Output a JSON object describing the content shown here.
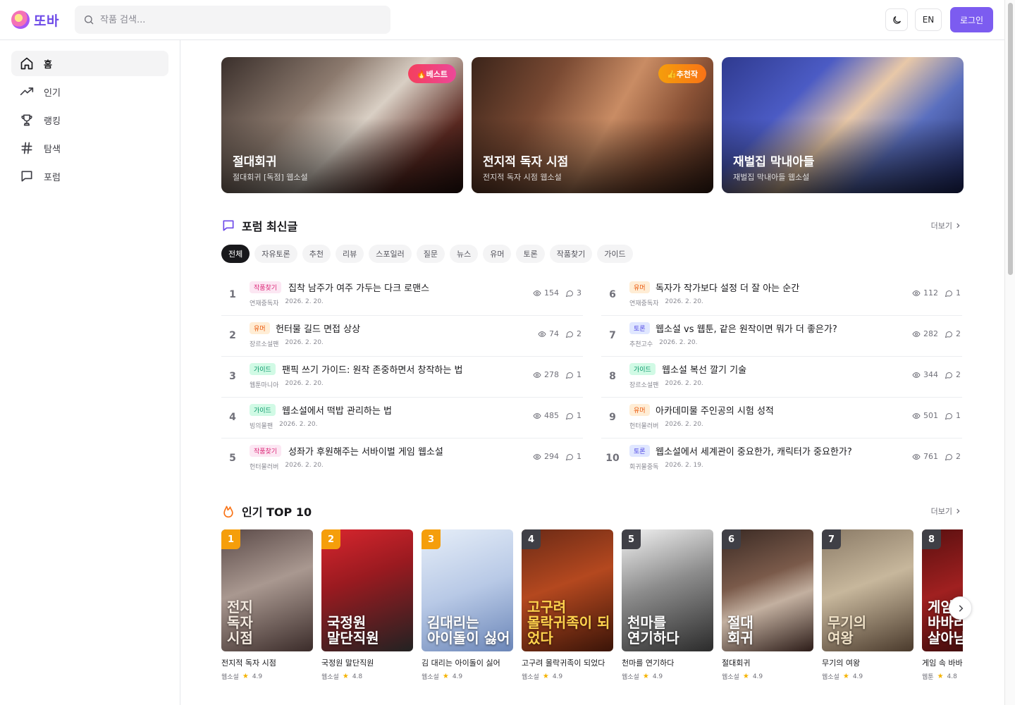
{
  "header": {
    "logo_text": "또바",
    "search_placeholder": "작품 검색...",
    "lang_label": "EN",
    "login_label": "로그인"
  },
  "sidebar": {
    "items": [
      {
        "label": "홈",
        "icon": "home-icon",
        "active": true
      },
      {
        "label": "인기",
        "icon": "trending-icon",
        "active": false
      },
      {
        "label": "랭킹",
        "icon": "trophy-icon",
        "active": false
      },
      {
        "label": "탐색",
        "icon": "hash-icon",
        "active": false
      },
      {
        "label": "포럼",
        "icon": "chat-icon",
        "active": false
      }
    ]
  },
  "banners": [
    {
      "title": "절대회귀",
      "subtitle": "절대회귀 [독점] 웹소설",
      "badge": "🔥베스트",
      "badge_color": "#f0407d"
    },
    {
      "title": "전지적 독자 시점",
      "subtitle": "전지적 독자 시점 웹소설",
      "badge": "👍추천작",
      "badge_color": "#f59e0b"
    },
    {
      "title": "재벌집 막내아들",
      "subtitle": "재벌집 막내아들 웹소설",
      "badge": "",
      "badge_color": ""
    }
  ],
  "forum": {
    "title": "포럼 최신글",
    "more_label": "더보기",
    "filters": [
      "전체",
      "자유토론",
      "추천",
      "리뷰",
      "스포일러",
      "질문",
      "뉴스",
      "유머",
      "토론",
      "작품찾기",
      "가이드"
    ],
    "posts": [
      {
        "rank": "1",
        "tag": "작품찾기",
        "title": "집착 남주가 여주 가두는 다크 로맨스",
        "author": "연재중독자",
        "date": "2026. 2. 20.",
        "views": "154",
        "comments": "3"
      },
      {
        "rank": "2",
        "tag": "유머",
        "title": "헌터물 길드 면접 상상",
        "author": "장르소설팬",
        "date": "2026. 2. 20.",
        "views": "74",
        "comments": "2"
      },
      {
        "rank": "3",
        "tag": "가이드",
        "title": "팬픽 쓰기 가이드: 원작 존중하면서 창작하는 법",
        "author": "웹툰마니아",
        "date": "2026. 2. 20.",
        "views": "278",
        "comments": "1"
      },
      {
        "rank": "4",
        "tag": "가이드",
        "title": "웹소설에서 떡밥 관리하는 법",
        "author": "빙의물팬",
        "date": "2026. 2. 20.",
        "views": "485",
        "comments": "1"
      },
      {
        "rank": "5",
        "tag": "작품찾기",
        "title": "성좌가 후원해주는 서바이벌 게임 웹소설",
        "author": "헌터물러버",
        "date": "2026. 2. 20.",
        "views": "294",
        "comments": "1"
      },
      {
        "rank": "6",
        "tag": "유머",
        "title": "독자가 작가보다 설정 더 잘 아는 순간",
        "author": "연재중독자",
        "date": "2026. 2. 20.",
        "views": "112",
        "comments": "1"
      },
      {
        "rank": "7",
        "tag": "토론",
        "title": "웹소설 vs 웹툰, 같은 원작이면 뭐가 더 좋은가?",
        "author": "추천고수",
        "date": "2026. 2. 20.",
        "views": "282",
        "comments": "2"
      },
      {
        "rank": "8",
        "tag": "가이드",
        "title": "웹소설 복선 깔기 기술",
        "author": "장르소설팬",
        "date": "2026. 2. 20.",
        "views": "344",
        "comments": "2"
      },
      {
        "rank": "9",
        "tag": "유머",
        "title": "아카데미물 주인공의 시험 성적",
        "author": "헌터물러버",
        "date": "2026. 2. 20.",
        "views": "501",
        "comments": "1"
      },
      {
        "rank": "10",
        "tag": "토론",
        "title": "웹소설에서 세계관이 중요한가, 캐릭터가 중요한가?",
        "author": "회귀물중독",
        "date": "2026. 2. 19.",
        "views": "761",
        "comments": "2"
      }
    ]
  },
  "top10": {
    "title": "인기 TOP 10",
    "more_label": "더보기",
    "works": [
      {
        "rank": "1",
        "title": "전지적 독자 시점",
        "type": "웹소설",
        "rating": "4.9",
        "cover_text": "전지\n독자\n시점"
      },
      {
        "rank": "2",
        "title": "국정원 말단직원",
        "type": "웹소설",
        "rating": "4.8",
        "cover_text": "국정원\n말단직원"
      },
      {
        "rank": "3",
        "title": "김 대리는 아이돌이 싫어",
        "type": "웹소설",
        "rating": "4.9",
        "cover_text": "김대리는\n아이돌이 싫어"
      },
      {
        "rank": "4",
        "title": "고구려 몰락귀족이 되었다",
        "type": "웹소설",
        "rating": "4.9",
        "cover_text": "고구려\n몰락귀족이 되었다"
      },
      {
        "rank": "5",
        "title": "천마를 연기하다",
        "type": "웹소설",
        "rating": "4.9",
        "cover_text": "천마를\n연기하다"
      },
      {
        "rank": "6",
        "title": "절대회귀",
        "type": "웹소설",
        "rating": "4.9",
        "cover_text": "절대\n회귀"
      },
      {
        "rank": "7",
        "title": "무기의 여왕",
        "type": "웹소설",
        "rating": "4.9",
        "cover_text": "무기의\n여왕"
      },
      {
        "rank": "8",
        "title": "게임 속 바바",
        "type": "웹툰",
        "rating": "4.8",
        "cover_text": "게임 속\n바바리\n살아남"
      }
    ]
  }
}
